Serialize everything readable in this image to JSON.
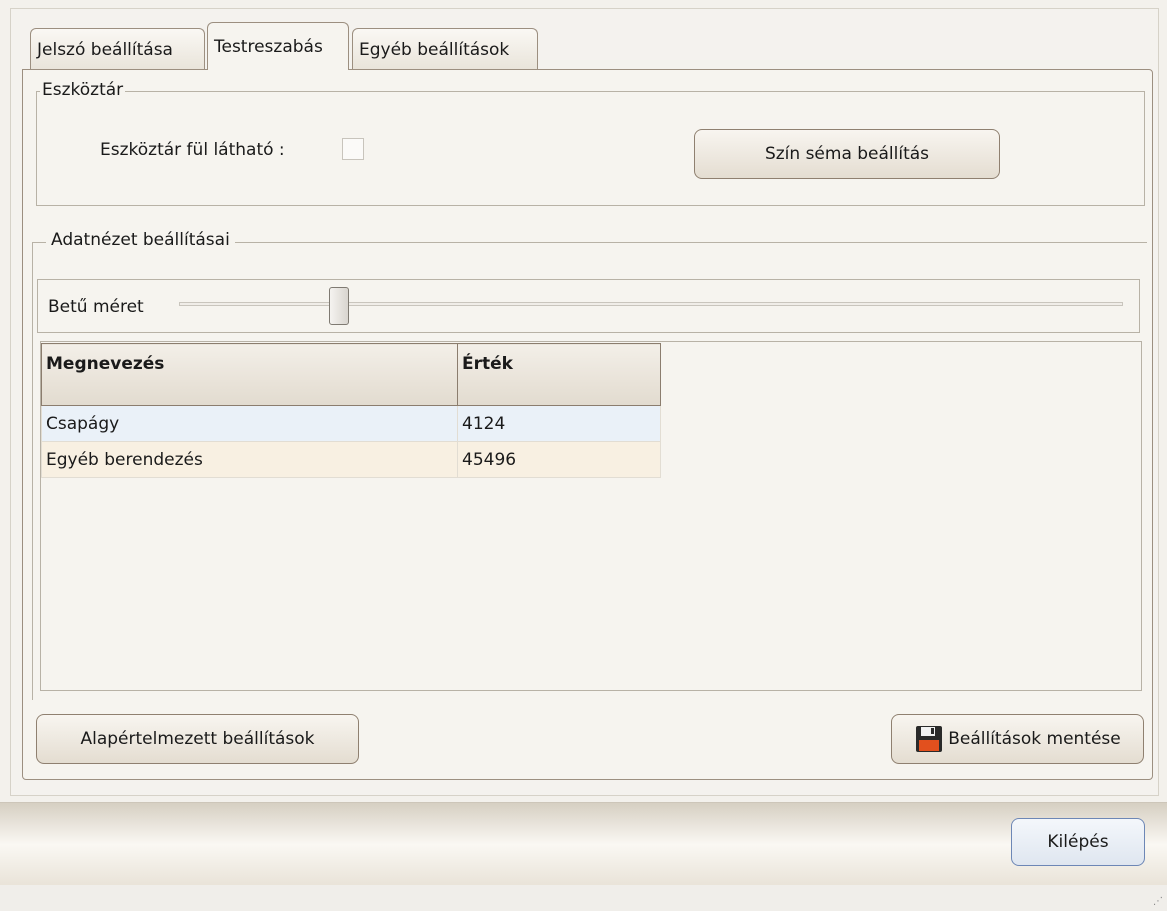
{
  "tabs": [
    {
      "label": "Jelszó beállítása"
    },
    {
      "label": "Testreszabás"
    },
    {
      "label": "Egyéb beállítások"
    }
  ],
  "eszkoztar": {
    "group_title": "Eszköztár",
    "checkbox_label": "Eszköztár fül látható :",
    "checkbox_checked": false,
    "color_button": "Szín séma beállítás"
  },
  "adatnezet": {
    "group_title": "Adatnézet beállításai",
    "slider_label": "Betű méret",
    "slider_level": 0.17,
    "columns": [
      "Megnevezés",
      "Érték"
    ],
    "rows": [
      [
        "Csapágy",
        "4124"
      ],
      [
        "Egyéb berendezés",
        "45496"
      ]
    ]
  },
  "buttons": {
    "defaults": "Alapértelmezett beállítások",
    "save": "Beállítások mentése",
    "exit": "Kilépés"
  },
  "colors": {
    "row_odd": "#eaf1f8",
    "row_even": "#f8f0e2",
    "save_icon_accent": "#e2501e"
  },
  "icons": {
    "save": "floppy-disk-icon"
  }
}
